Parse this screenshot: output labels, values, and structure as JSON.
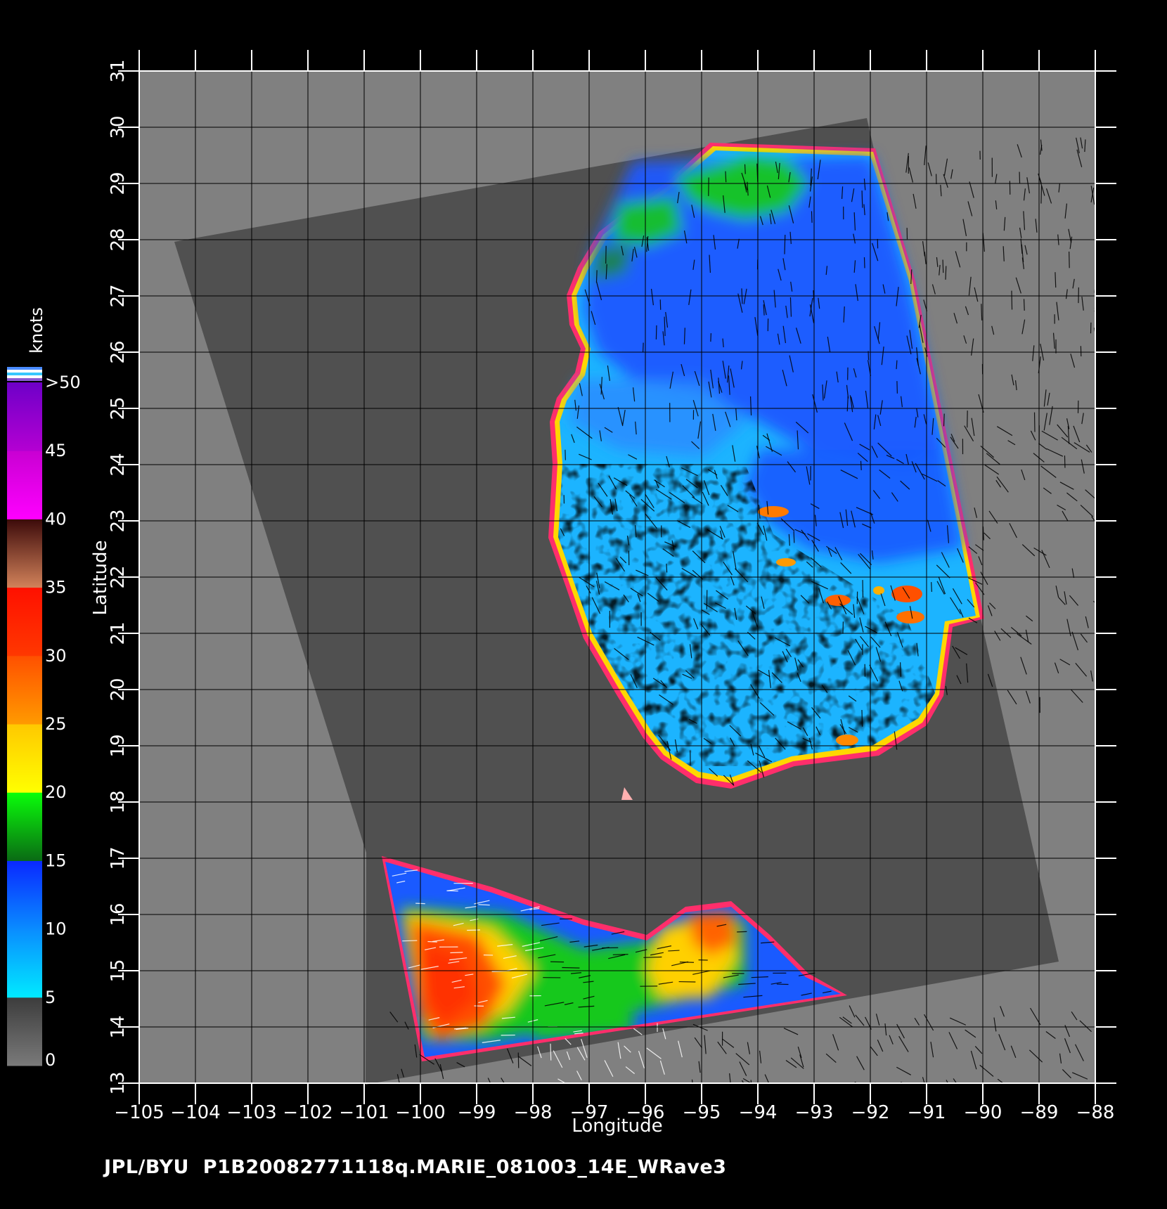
{
  "map": {
    "lon_range": [
      -105,
      -88
    ],
    "lat_range": [
      13,
      31
    ],
    "x_title": "Longitude",
    "y_title": "Latitude",
    "lon_ticks": [
      "-105",
      "-104",
      "-103",
      "-102",
      "-101",
      "-100",
      "-99",
      "-98",
      "-97",
      "-96",
      "-95",
      "-94",
      "-93",
      "-92",
      "-91",
      "-90",
      "-89",
      "-88"
    ],
    "lat_ticks": [
      "13",
      "14",
      "15",
      "16",
      "17",
      "18",
      "19",
      "20",
      "21",
      "22",
      "23",
      "24",
      "25",
      "26",
      "27",
      "28",
      "29",
      "30",
      "31"
    ],
    "background_color": "#808080",
    "swath_color": "#505050",
    "grid": true
  },
  "legend": {
    "title": "knots",
    "labels": [
      "0",
      "5",
      "10",
      "15",
      "20",
      "25",
      "30",
      "35",
      "40",
      "45",
      ">50"
    ],
    "bands": [
      {
        "range": "0-5",
        "colors": [
          "#7a7a7a",
          "#3c3c3c"
        ]
      },
      {
        "range": "5-10",
        "colors": [
          "#00eaff",
          "#0a8cff"
        ]
      },
      {
        "range": "10-15",
        "colors": [
          "#0a8cff",
          "#0a28ff"
        ]
      },
      {
        "range": "15-20",
        "colors": [
          "#0a6a14",
          "#0aff0a"
        ]
      },
      {
        "range": "20-25",
        "colors": [
          "#ffff00",
          "#ffc800"
        ]
      },
      {
        "range": "25-30",
        "colors": [
          "#ff9a00",
          "#ff5000"
        ]
      },
      {
        "range": "30-35",
        "colors": [
          "#ff3800",
          "#ff1000"
        ]
      },
      {
        "range": "35-40",
        "colors": [
          "#d2825a",
          "#3c0a0a"
        ]
      },
      {
        "range": "40-45",
        "colors": [
          "#ff00ff",
          "#c800d2"
        ]
      },
      {
        "range": "45-50",
        "colors": [
          "#b400d2",
          "#6e00c8"
        ]
      }
    ]
  },
  "footer": "JPL/BYU  P1B20082771118q.MARIE_081003_14E_WRave3"
}
